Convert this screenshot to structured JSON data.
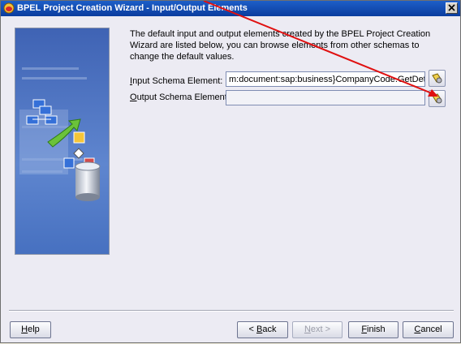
{
  "window": {
    "title": "BPEL Project Creation Wizard - Input/Output Elements"
  },
  "description": "The default input and output elements created by the BPEL Project Creation Wizard are listed below, you can browse elements from other schemas to change the default values.",
  "input_schema": {
    "label_first": "I",
    "label_rest": "nput Schema Element:",
    "value": "m:document:sap:business}CompanyCode.GetDetail"
  },
  "output_schema": {
    "label_first": "O",
    "label_rest": "utput Schema Element:",
    "value": ""
  },
  "buttons": {
    "help_first": "H",
    "help_rest": "elp",
    "back_prefix": "< ",
    "back_first": "B",
    "back_rest": "ack",
    "next_first": "N",
    "next_rest": "ext >",
    "finish_first": "F",
    "finish_rest": "inish",
    "cancel_first": "C",
    "cancel_rest": "ancel"
  },
  "colors": {
    "annotation_arrow": "#e01010",
    "title_bar": "#0a3c9e",
    "side_image": "#4f79c6"
  },
  "icons": {
    "app": "oracle-jdeveloper-icon",
    "browse": "flashlight-browse-icon",
    "close": "close-icon"
  }
}
